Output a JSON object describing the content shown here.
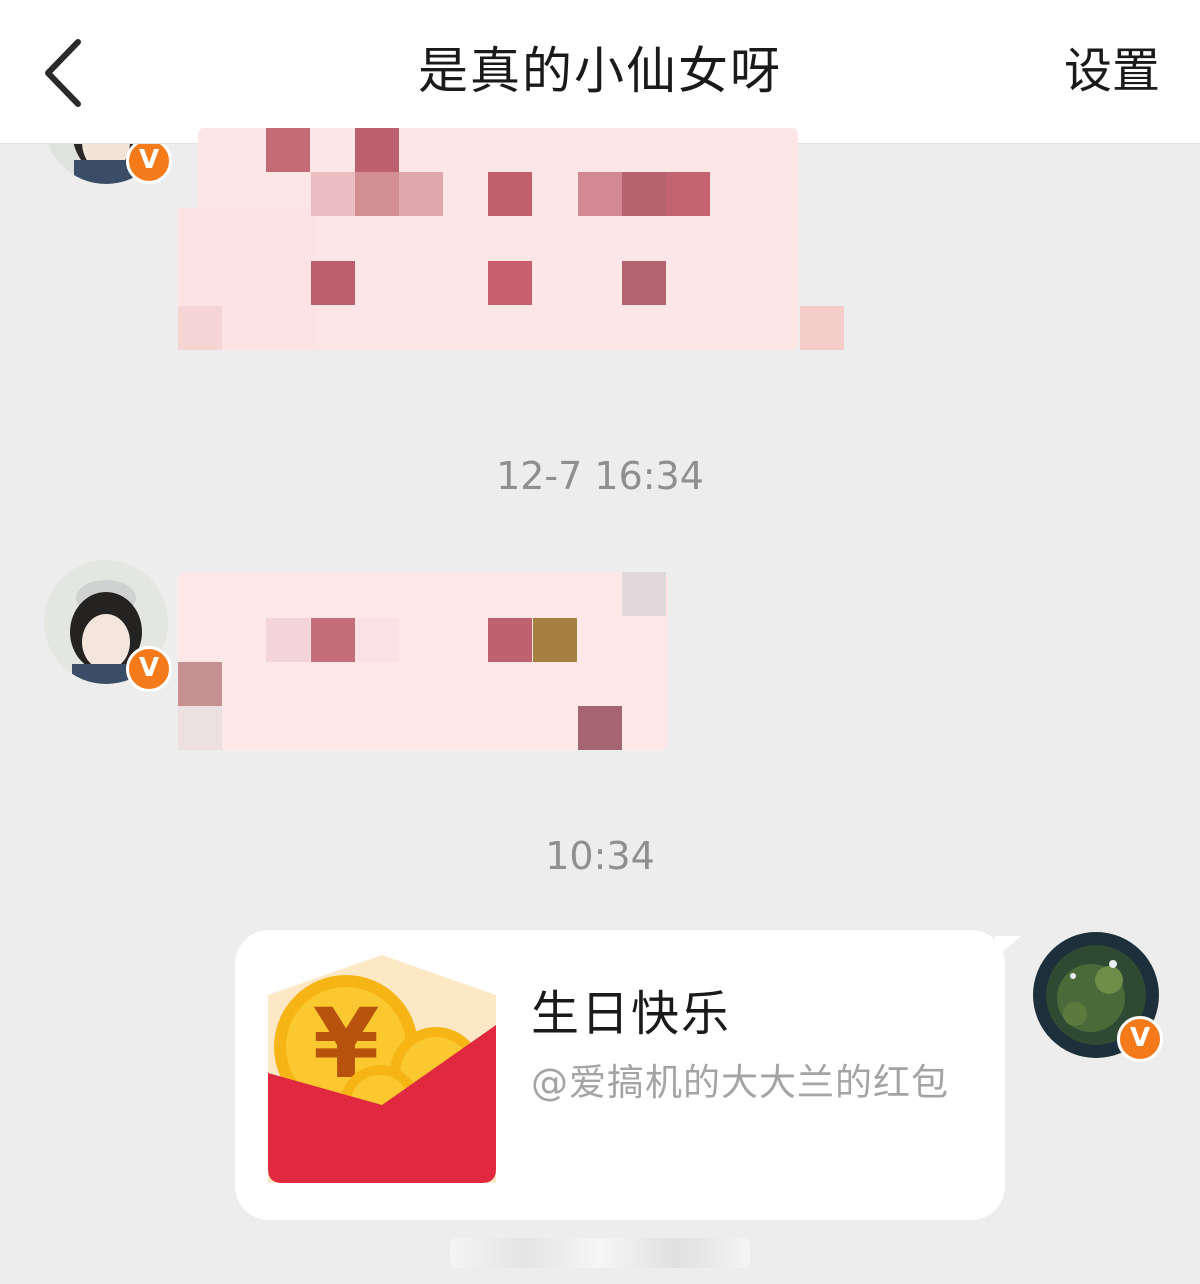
{
  "header": {
    "title": "是真的小仙女呀",
    "settings_label": "设置",
    "back_icon": "chevron-left-icon"
  },
  "messages": [
    {
      "type": "image",
      "sender": "contact",
      "content": "censored-sticker"
    },
    {
      "type": "timestamp",
      "text": "12-7 16:34"
    },
    {
      "type": "image",
      "sender": "contact",
      "content": "censored-sticker"
    },
    {
      "type": "timestamp",
      "text": "10:34"
    },
    {
      "type": "red_packet",
      "sender": "self",
      "title": "生日快乐",
      "subtitle": "@爱搞机的大大兰的红包"
    }
  ],
  "badges": {
    "verified_label": "V"
  },
  "colors": {
    "badge": "#f57a1a",
    "red_packet": "#e0293f",
    "coin": "#f7b515"
  }
}
